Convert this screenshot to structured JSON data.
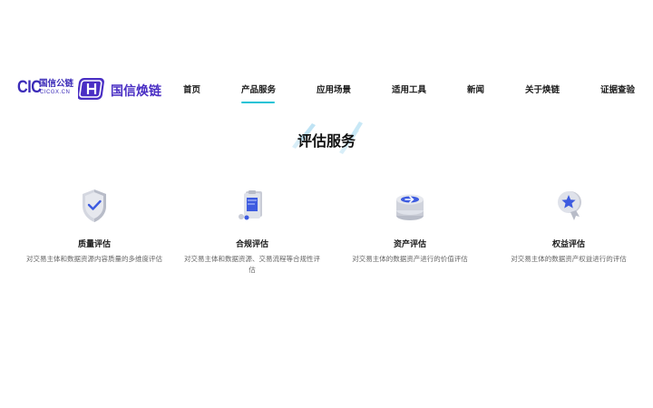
{
  "header": {
    "logo_cic": {
      "mark": "CIC",
      "name": "国信公链",
      "url": "CICGX.CN"
    },
    "logo_main": {
      "name": "国信焕链"
    },
    "nav": [
      {
        "label": "首页",
        "active": false
      },
      {
        "label": "产品服务",
        "active": true
      },
      {
        "label": "应用场景",
        "active": false
      },
      {
        "label": "适用工具",
        "active": false
      },
      {
        "label": "新闻",
        "active": false
      },
      {
        "label": "关于焕链",
        "active": false
      },
      {
        "label": "证据查验",
        "active": false
      }
    ]
  },
  "section": {
    "title": "评估服务"
  },
  "services": [
    {
      "icon": "shield-check-icon",
      "name": "质量评估",
      "desc": "对交易主体和数据资源内容质量的多维度评估"
    },
    {
      "icon": "clipboard-compliance-icon",
      "name": "合规评估",
      "desc": "对交易主体和数据资源、交易流程等合规性评估"
    },
    {
      "icon": "coin-stack-icon",
      "name": "资产评估",
      "desc": "对交易主体的数据资产进行的价值评估"
    },
    {
      "icon": "star-badge-icon",
      "name": "权益评估",
      "desc": "对交易主体的数据资产权益进行的评估"
    }
  ],
  "colors": {
    "brand": "#3b2bb8",
    "accent": "#1bc3d6",
    "icon_blue": "#3d5be0"
  }
}
